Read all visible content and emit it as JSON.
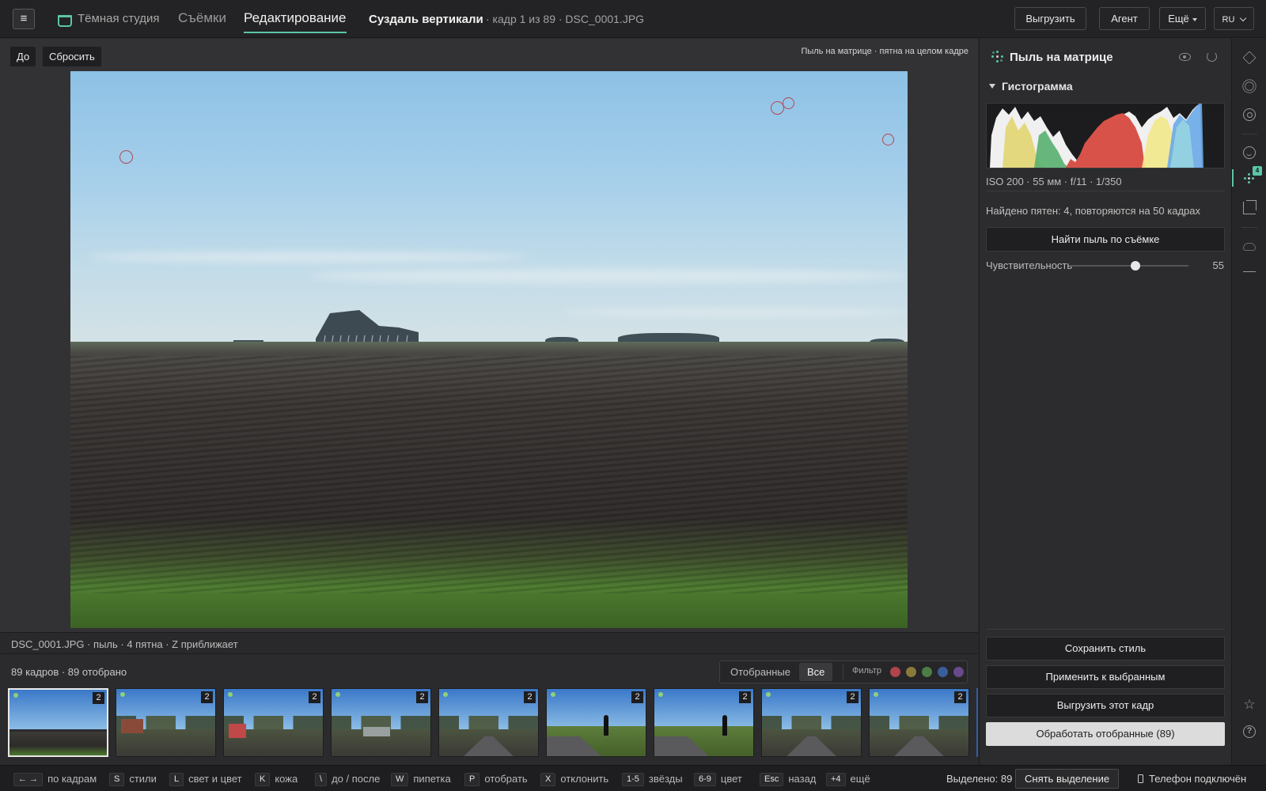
{
  "app": {
    "brand": "Тёмная студия",
    "tabs": [
      {
        "label": "Съёмки",
        "active": false
      },
      {
        "label": "Редактирование",
        "active": true
      }
    ],
    "project_title": "Суздаль вертикали",
    "frame_meta": "· кадр 1 из 89 · DSC_0001.JPG",
    "buttons": {
      "export": "Выгрузить",
      "agent": "Агент",
      "more": "Ещё",
      "lang": "RU"
    },
    "accent_color": "#5ac6a8"
  },
  "viewer": {
    "before_label": "До",
    "reset_label": "Сбросить",
    "hint": "Пыль на матрице · пятна на целом кадре",
    "file_status": "DSC_0001.JPG · пыль · 4 пятна · Z приближает",
    "dust_spot_count": 4
  },
  "filmstrip": {
    "count_label": "89 кадров · 89 отобрано",
    "segments": {
      "picked": "Отобранные",
      "all": "Все"
    },
    "filter_label": "Фильтр",
    "filter_colors": [
      "#b0444a",
      "#8a7a3a",
      "#4a7e44",
      "#3a5e9a",
      "#6a4a8a"
    ],
    "thumbs": [
      {
        "kind": "field",
        "badge": "2",
        "selected": true
      },
      {
        "kind": "village",
        "badge": "2",
        "selected": false
      },
      {
        "kind": "village",
        "badge": "2",
        "selected": false
      },
      {
        "kind": "houses",
        "badge": "2",
        "selected": false
      },
      {
        "kind": "road",
        "badge": "2",
        "selected": false
      },
      {
        "kind": "person",
        "badge": "2",
        "selected": false
      },
      {
        "kind": "person",
        "badge": "2",
        "selected": false
      },
      {
        "kind": "road",
        "badge": "2",
        "selected": false
      },
      {
        "kind": "road",
        "badge": "2",
        "selected": false
      }
    ]
  },
  "panel": {
    "title": "Пыль на матрице",
    "histogram_title": "Гистограмма",
    "exif": "ISO 200 · 55 мм · f/11 · 1/350",
    "found_text": "Найдено пятен: 4, повторяются на 50 кадрах",
    "find_button": "Найти пыль по съёмке",
    "sensitivity_label": "Чувствительность",
    "sensitivity_value": "55",
    "sensitivity_fraction": 0.55,
    "actions": {
      "save_style": "Сохранить стиль",
      "apply_selected": "Применить к выбранным",
      "export_frame": "Выгрузить этот кадр",
      "process_picked": "Обработать отобранные (89)"
    }
  },
  "rail": {
    "dust_badge": "4",
    "icons": [
      "layers-icon",
      "light-icon",
      "color-icon",
      "face-icon",
      "dust-icon",
      "crop-icon",
      "cloud-icon",
      "link-icon",
      "star-icon",
      "help-icon"
    ]
  },
  "shortcuts": [
    {
      "key": "← →",
      "label": "по кадрам"
    },
    {
      "key": "S",
      "label": "стили"
    },
    {
      "key": "L",
      "label": "свет и цвет"
    },
    {
      "key": "K",
      "label": "кожа"
    },
    {
      "key": "\\",
      "label": "до / после"
    },
    {
      "key": "W",
      "label": "пипетка"
    },
    {
      "key": "P",
      "label": "отобрать"
    },
    {
      "key": "X",
      "label": "отклонить"
    },
    {
      "key": "1-5",
      "label": "звёзды"
    },
    {
      "key": "6-9",
      "label": "цвет"
    },
    {
      "key": "Esc",
      "label": "назад"
    },
    {
      "key": "+4",
      "label": "ещё"
    }
  ],
  "status": {
    "selected": "Выделено: 89",
    "deselect": "Снять выделение",
    "phone": "Телефон подключён"
  }
}
